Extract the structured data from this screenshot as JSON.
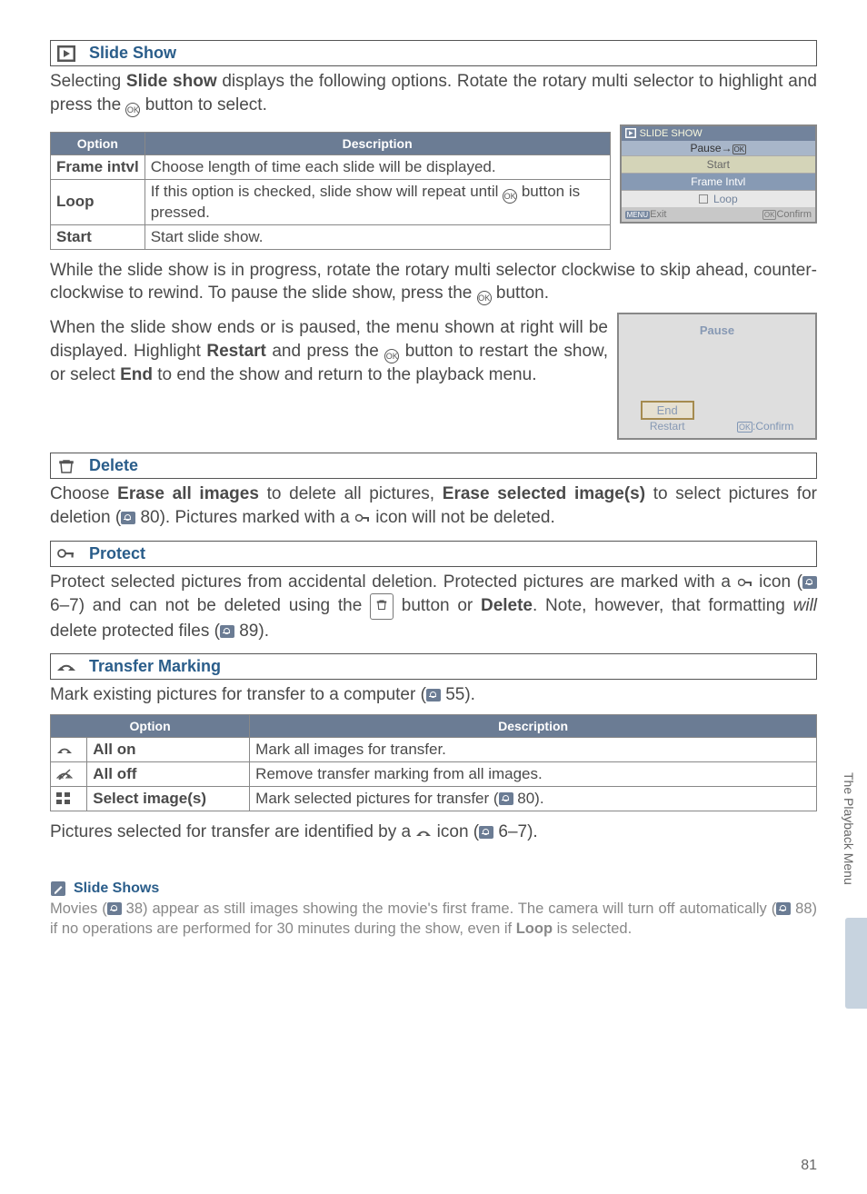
{
  "sections": {
    "slideshow": {
      "title": "Slide Show",
      "intro_a": "Selecting ",
      "intro_b": "Slide show",
      "intro_c": " displays the following options.  Rotate the rotary multi selector to highlight and press the ",
      "intro_d": " button to select.",
      "table": {
        "h1": "Option",
        "h2": "Description",
        "r1a": "Frame intvl",
        "r1b": "Choose length of time each slide will be displayed.",
        "r2a": "Loop",
        "r2b_a": "If this option is checked, slide show will repeat until ",
        "r2b_b": " button is pressed.",
        "r3a": "Start",
        "r3b": "Start slide show."
      },
      "screen": {
        "title": "SLIDE SHOW",
        "pause": "Pause→",
        "i1": "Start",
        "i2": "Frame Intvl",
        "i3": "Loop",
        "exit": "Exit",
        "confirm": "Confirm"
      },
      "mid_a": "While the slide show is in progress, rotate the rotary multi selector clockwise to skip ahead, counter-clockwise to rewind.  To pause the slide show, press the ",
      "mid_b": " button.",
      "end_a": "When the slide show ends or is paused, the menu shown at right will be displayed.  Highlight ",
      "end_b": "Restart",
      "end_c": " and press the ",
      "end_d": " button to restart the show, or select ",
      "end_e": "End",
      "end_f": " to end the show and return to the playback menu.",
      "screen2": {
        "title": "Pause",
        "end": "End",
        "restart": "Restart",
        "confirm": ":Confirm"
      }
    },
    "delete": {
      "title": "Delete",
      "a": "Choose ",
      "b": "Erase all images",
      "c": " to delete all pictures, ",
      "d": "Erase selected image(s)",
      "e": " to select pictures for deletion (",
      "f": " 80).  Pictures marked with a ",
      "g": " icon will not be deleted."
    },
    "protect": {
      "title": "Protect",
      "a": "Protect selected pictures from accidental deletion.  Protected pictures are marked with a ",
      "b": " icon (",
      "c": " 6–7) and can not be deleted using the ",
      "d": " button or ",
      "e": "Delete",
      "f": ".  Note, however, that formatting ",
      "g": "will",
      "h": " delete protected files (",
      "i": " 89)."
    },
    "transfer": {
      "title": "Transfer Marking",
      "intro_a": "Mark existing pictures for transfer to a computer (",
      "intro_b": " 55).",
      "table": {
        "h1": "Option",
        "h2": "Description",
        "r1a": "All on",
        "r1b": "Mark all images for transfer.",
        "r2a": "All off",
        "r2b": "Remove transfer marking from all images.",
        "r3a": "Select image(s)",
        "r3b_a": "Mark selected pictures for transfer (",
        "r3b_b": " 80)."
      },
      "out_a": "Pictures selected for transfer are identified by a ",
      "out_b": " icon (",
      "out_c": " 6–7)."
    },
    "tip": {
      "title": "Slide Shows",
      "a": "Movies (",
      "b": " 38) appear as still images showing the movie's first frame.  The camera will turn off automatically (",
      "c": " 88) if no operations are performed for 30 minutes during the show, even if ",
      "d": "Loop",
      "e": " is selected."
    }
  },
  "sidebar": "The Playback Menu",
  "page": "81",
  "ok_glyph": "OK"
}
